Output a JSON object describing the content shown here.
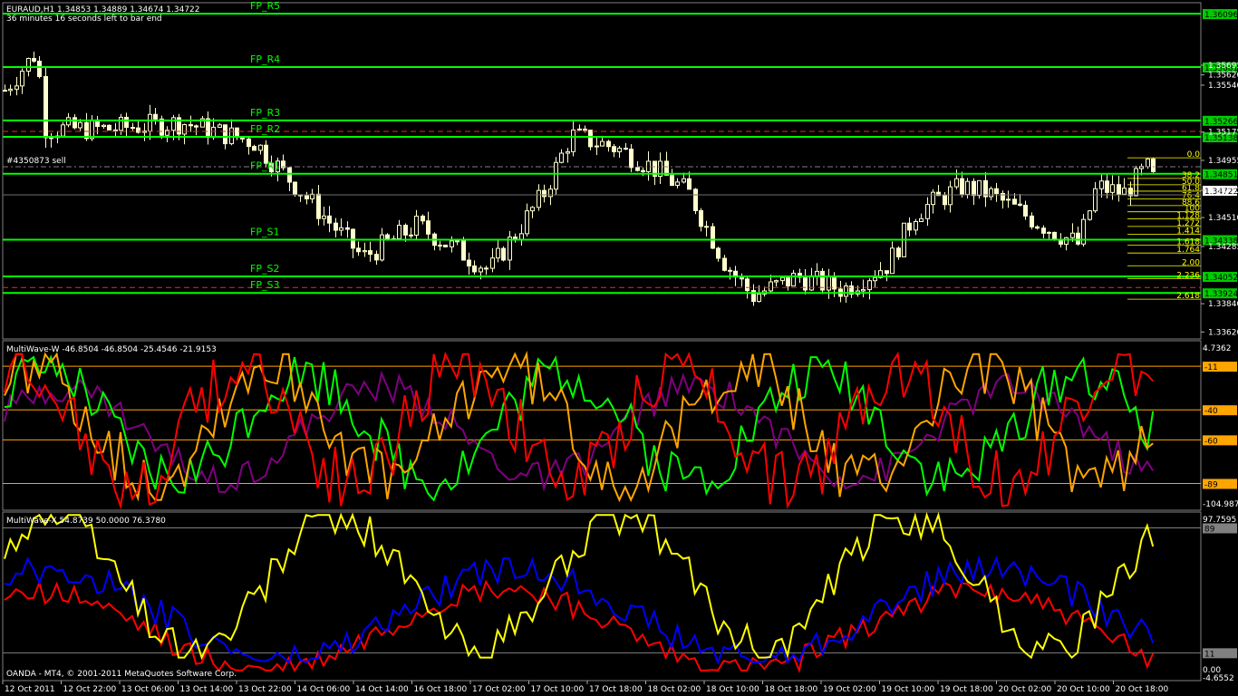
{
  "header": {
    "symbol_line": "EURAUD,H1  1.34853 1.34889 1.34674 1.34722",
    "timer": "36 minutes 16 seconds left to bar end",
    "order_label": "#4350873 sell"
  },
  "main_panel": {
    "price_ticks": [
      "1.35695",
      "1.35620",
      "1.35540",
      "1.35175",
      "1.34955",
      "1.34722",
      "1.34510",
      "1.34285",
      "1.33840",
      "1.33620"
    ],
    "pivot_lines": [
      {
        "label": "FP_R5",
        "price": "1.36096"
      },
      {
        "label": "FP_R4",
        "price": "1.35681"
      },
      {
        "label": "FP_R3",
        "price": "1.35266"
      },
      {
        "label": "FP_R2",
        "price": "1.35138"
      },
      {
        "label": "FP_R1",
        "price": "1.34851"
      },
      {
        "label": "FP_S1",
        "price": "1.34338"
      },
      {
        "label": "FP_S2",
        "price": "1.34052"
      },
      {
        "label": "FP_S3",
        "price": "1.33924"
      }
    ],
    "current_price": "1.34722",
    "fib_levels": [
      "0.0",
      "38.2",
      "50.0",
      "61.8",
      "76.4",
      "88.6",
      "100",
      "1.128",
      "1.272",
      "1.414",
      "1.618",
      "1.764",
      "2.00",
      "2.236",
      "2.618"
    ]
  },
  "multiwave_w": {
    "title": "MultiWave-W -46.8504 -46.8504 -25.4546 -21.9153",
    "top_value": "4.7362",
    "bottom_value": "-104.987",
    "levels": [
      "-11",
      "-40",
      "-60",
      "-89"
    ]
  },
  "multiwave_x": {
    "title": "MultiWave-X 54.8739 50.0000 76.3780",
    "top_value": "97.7595",
    "level_89": "89",
    "level_11": "11",
    "bottom_value": "0.00",
    "bottom_value2": "-4.6552"
  },
  "x_axis": {
    "labels": [
      "12 Oct 2011",
      "12 Oct 22:00",
      "13 Oct 06:00",
      "13 Oct 14:00",
      "13 Oct 22:00",
      "14 Oct 06:00",
      "14 Oct 14:00",
      "16 Oct 18:00",
      "17 Oct 02:00",
      "17 Oct 10:00",
      "17 Oct 18:00",
      "18 Oct 02:00",
      "18 Oct 10:00",
      "18 Oct 18:00",
      "19 Oct 02:00",
      "19 Oct 10:00",
      "19 Oct 18:00",
      "20 Oct 02:00",
      "20 Oct 10:00",
      "20 Oct 18:00"
    ]
  },
  "footer": {
    "copyright": "OANDA - MT4, © 2001-2011 MetaQuotes Software Corp."
  },
  "colors": {
    "background": "#000000",
    "candle_up": "#ffffcc",
    "pivot_green": "#00ff00",
    "dashed_red": "#ff2020",
    "fib_yellow": "#ffff00",
    "level_orange": "#ffa500"
  }
}
